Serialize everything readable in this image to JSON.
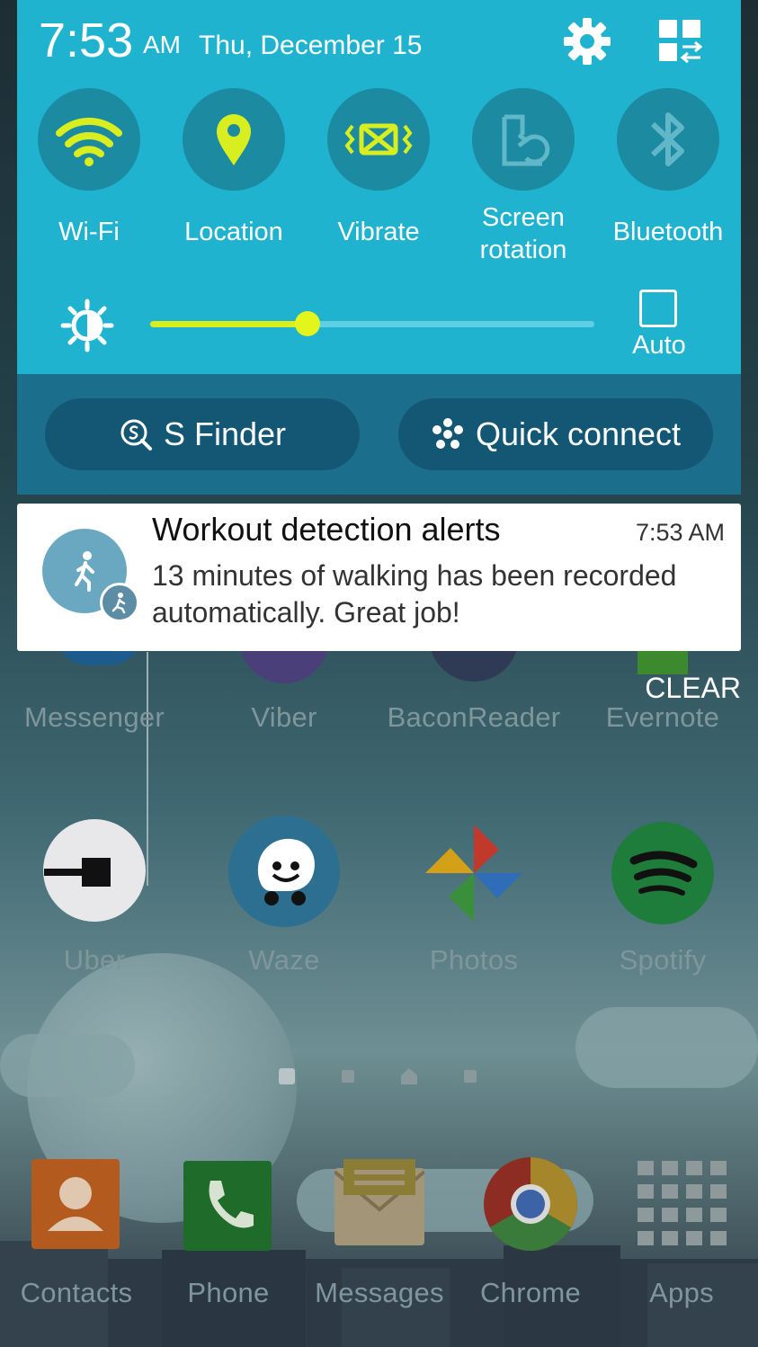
{
  "status": {
    "time": "7:53",
    "ampm": "AM",
    "date": "Thu, December 15"
  },
  "quick_panel": {
    "toggles": [
      {
        "label": "Wi-Fi",
        "icon": "wifi-icon",
        "state": "on"
      },
      {
        "label": "Location",
        "icon": "location-pin-icon",
        "state": "on"
      },
      {
        "label": "Vibrate",
        "icon": "vibrate-icon",
        "state": "on"
      },
      {
        "label": "Screen rotation",
        "icon": "screen-rotation-icon",
        "state": "off"
      },
      {
        "label": "Bluetooth",
        "icon": "bluetooth-icon",
        "state": "off"
      }
    ],
    "brightness": {
      "level": 0.355,
      "auto_label": "Auto"
    },
    "s_finder_label": "S Finder",
    "quick_connect_label": "Quick connect"
  },
  "notification": {
    "title": "Workout detection alerts",
    "time": "7:53 AM",
    "body": "13 minutes of walking has been recorded automatically. Great job!",
    "icon": "walking-person-icon"
  },
  "clear_label": "CLEAR",
  "home": {
    "row1": [
      "Messenger",
      "Viber",
      "BaconReader",
      "Evernote"
    ],
    "row2": [
      "Uber",
      "Waze",
      "Photos",
      "Spotify"
    ],
    "dock": [
      "Contacts",
      "Phone",
      "Messages",
      "Chrome",
      "Apps"
    ]
  },
  "colors": {
    "panel": "#1fb3d0",
    "panel_dark": "#1b6e8c",
    "toggle_on": "#d8ee1e",
    "toggle_off": "#5fb7c8"
  }
}
